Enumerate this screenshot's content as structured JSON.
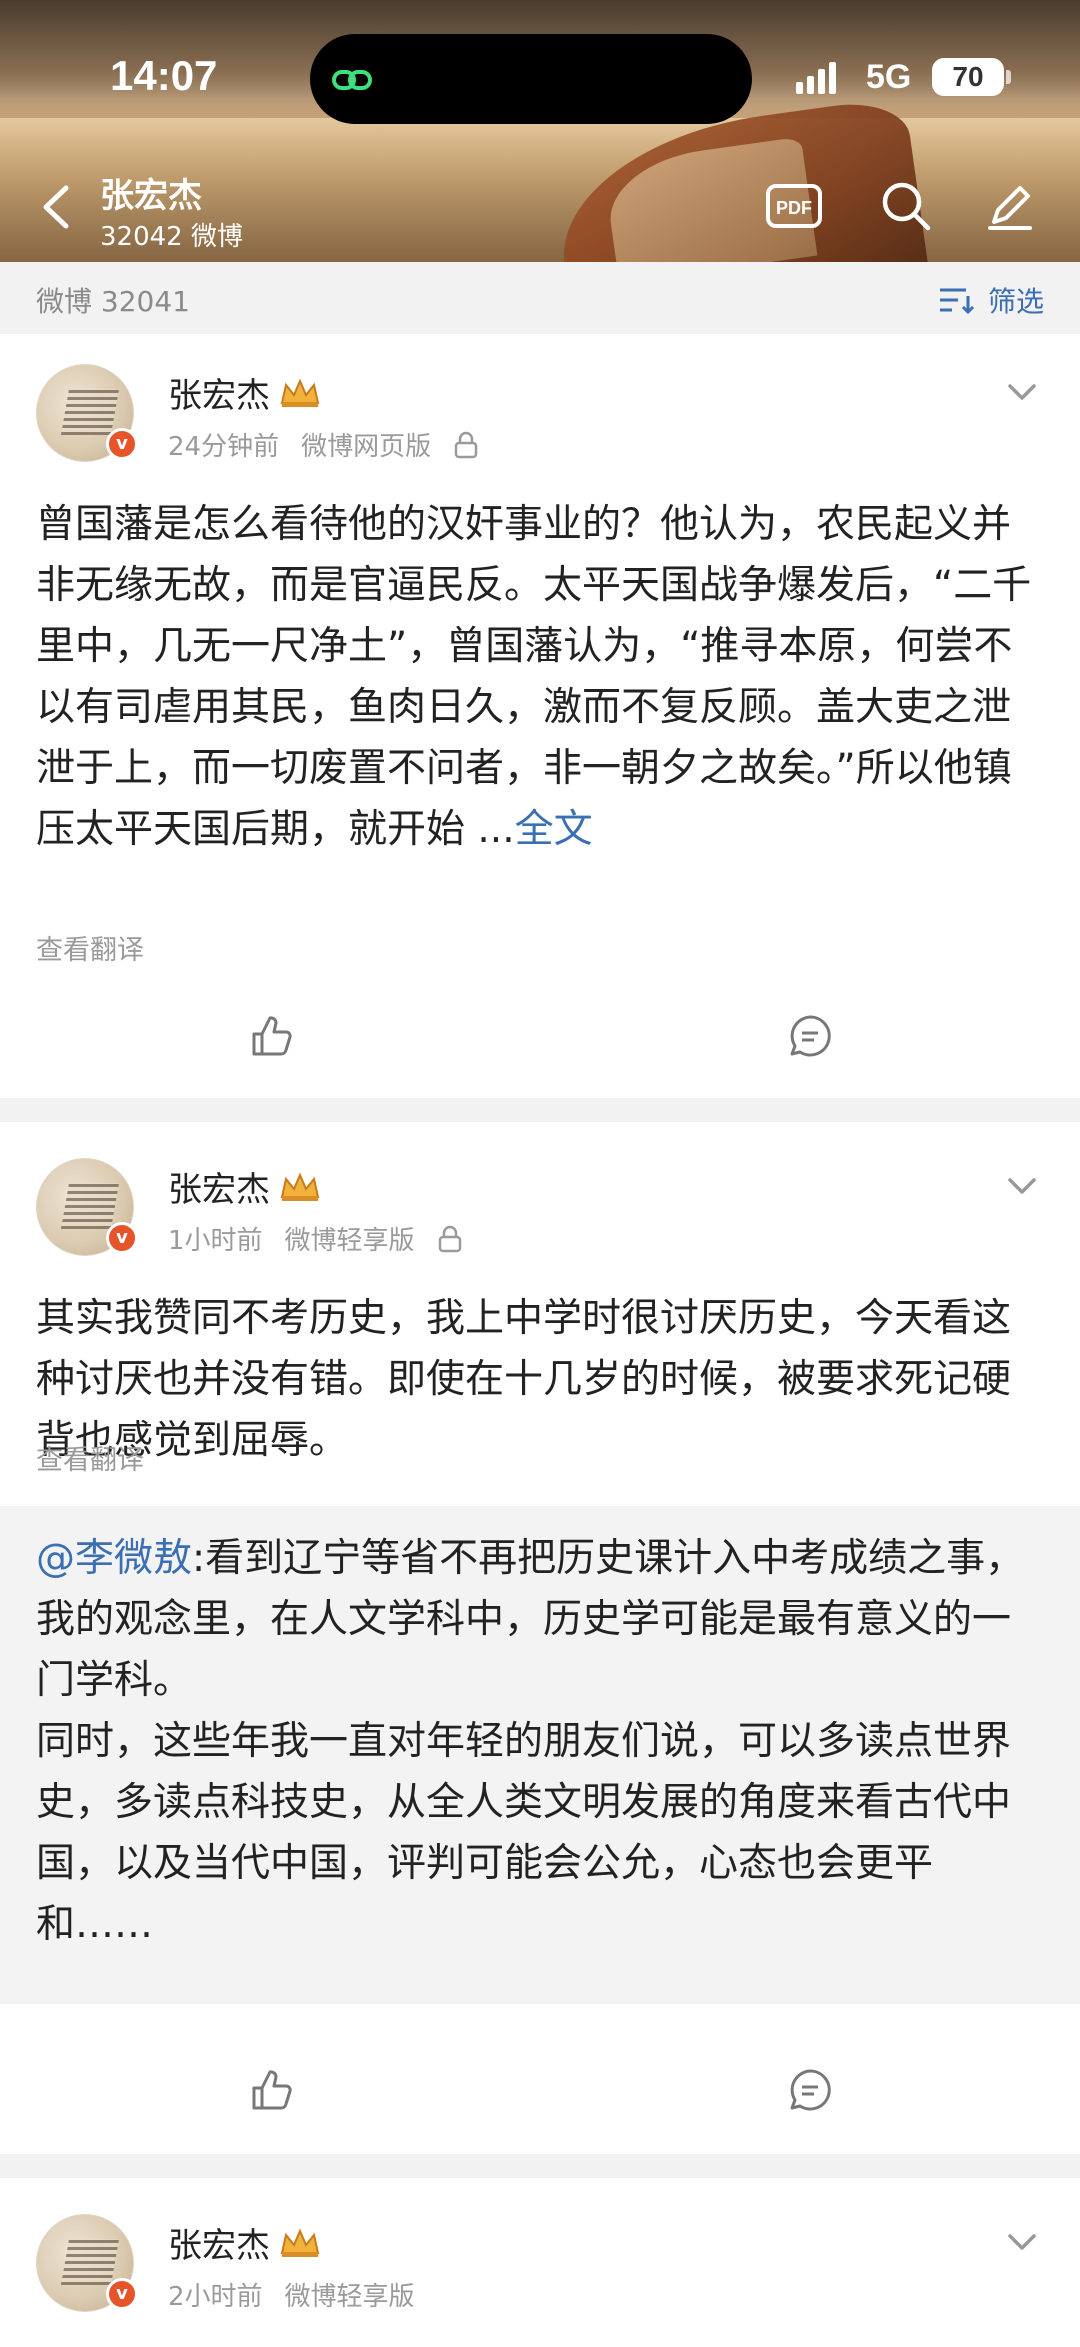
{
  "status_bar": {
    "time": "14:07",
    "network": "5G",
    "battery": "70"
  },
  "header": {
    "name": "张宏杰",
    "subtitle": "32042 微博",
    "pdf_label": "PDF"
  },
  "subbar": {
    "count": "微博 32041",
    "filter_label": "筛选"
  },
  "posts": [
    {
      "author": "张宏杰",
      "time": "24分钟前",
      "source": "微博网页版",
      "text": "曾国藩是怎么看待他的汉奸事业的？他认为，农民起义并非无缘无故，而是官逼民反。太平天国战争爆发后，“二千里中，几无一尺净土”，曾国藩认为，“推寻本原，何尝不以有司虐用其民，鱼肉日久，激而不复反顾。盖大吏之泄泄于上，而一切废置不问者，非一朝夕之故矣。”所以他镇压太平天国后期，就开始 ...",
      "more": "全文",
      "translate": "查看翻译"
    },
    {
      "author": "张宏杰",
      "time": "1小时前",
      "source": "微博轻享版",
      "text": "其实我赞同不考历史，我上中学时很讨厌历史，今天看这种讨厌也并没有错。即使在十几岁的时候，被要求死记硬背也感觉到屈辱。",
      "translate": "查看翻译",
      "repost_mention": "@李微敖",
      "repost_text": ":看到辽宁等省不再把历史课计入中考成绩之事，我的观念里，在人文学科中，历史学可能是最有意义的一门学科。\n同时，这些年我一直对年轻的朋友们说，可以多读点世界史，多读点科技史，从全人类文明发展的角度来看古代中国，以及当代中国，评判可能会公允，心态也会更平和……"
    },
    {
      "author": "张宏杰",
      "time": "2小时前",
      "source": "微博轻享版"
    }
  ]
}
